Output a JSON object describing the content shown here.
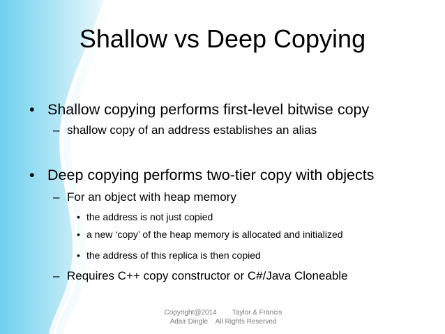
{
  "slide": {
    "title": "Shallow vs Deep Copying",
    "bullets": [
      {
        "level": 1,
        "marker": "•",
        "text": "Shallow copying performs first-level bitwise copy"
      },
      {
        "level": 2,
        "marker": "–",
        "text": "shallow copy of an address establishes an alias"
      },
      {
        "level": 1,
        "marker": "•",
        "text": "Deep copying performs two-tier copy with objects"
      },
      {
        "level": 2,
        "marker": "–",
        "text": "For an object with heap memory"
      },
      {
        "level": 3,
        "marker": "•",
        "text": "the address is not just copied"
      },
      {
        "level": 3,
        "marker": "•",
        "text": "a new ‘copy’ of the heap memory is allocated and initialized"
      },
      {
        "level": 3,
        "marker": "•",
        "text": "the address of this replica is then copied"
      },
      {
        "level": 2,
        "marker": "–",
        "text": "Requires C++ copy constructor or C#/Java Cloneable"
      }
    ],
    "footer": {
      "line1": "Copyright@2014        Taylor & Francis",
      "line2": "Adair Dingle    All Rights Reserved"
    }
  },
  "theme": {
    "accent_light": "#d9f2fb",
    "accent_mid": "#9fdff3",
    "accent_dark": "#5cc8ea"
  }
}
